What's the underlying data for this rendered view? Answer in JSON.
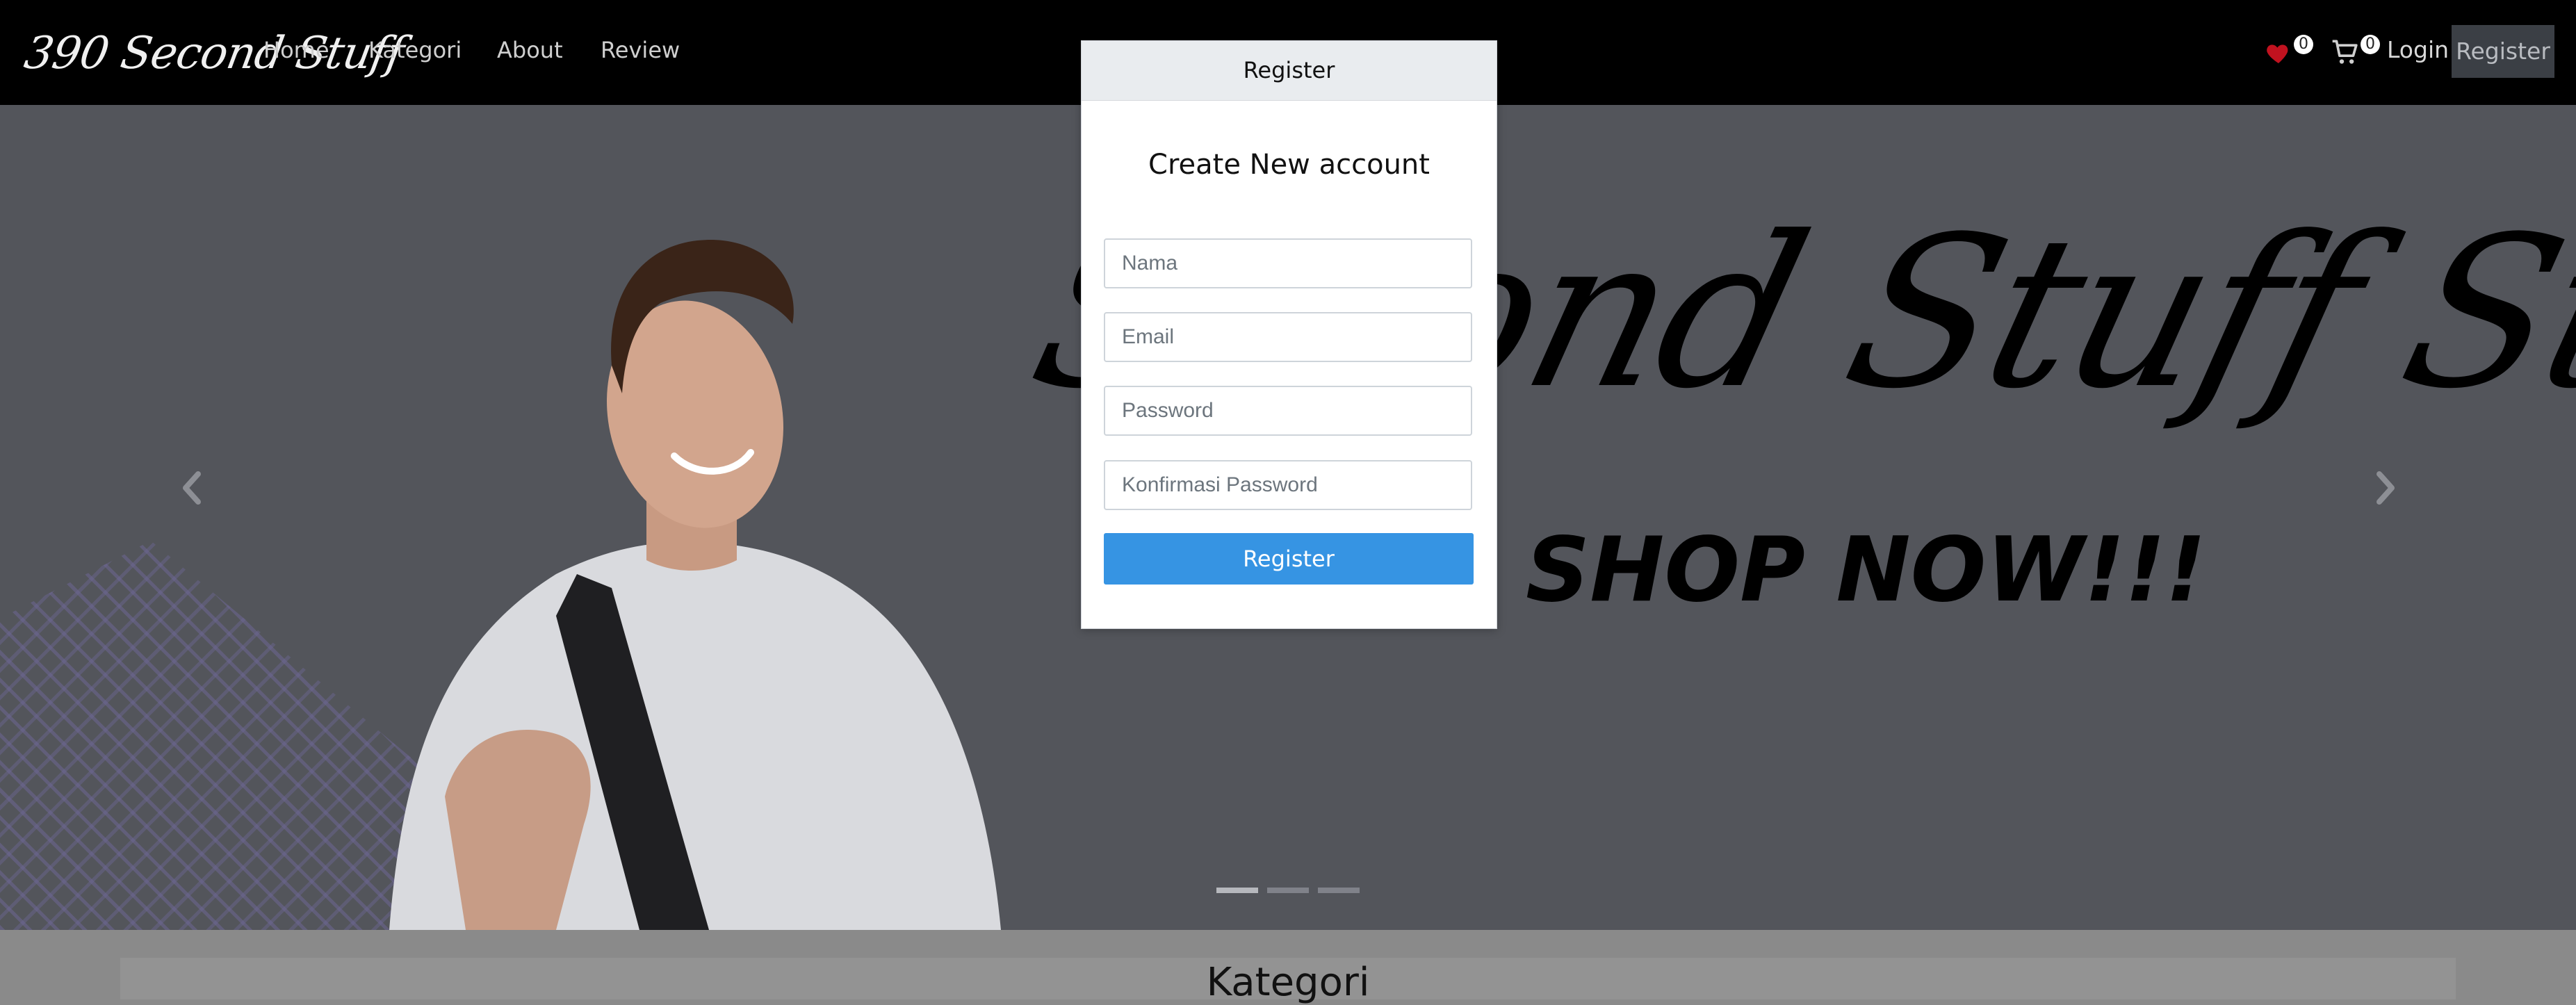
{
  "navbar": {
    "brand": "390 Second Stuff",
    "links": [
      "Home",
      "Kategori",
      "About",
      "Review"
    ],
    "wishlist_count": "0",
    "cart_count": "0",
    "login_label": "Login",
    "register_label": "Register"
  },
  "hero": {
    "script_text": "Second Stuff Stores",
    "cta_text": "SHOP NOW!!!",
    "prev_icon": "chevron-left-icon",
    "next_icon": "chevron-right-icon",
    "active_slide": 1,
    "slide_count": 3
  },
  "modal": {
    "header": "Register",
    "title": "Create New account",
    "fields": {
      "name_placeholder": "Nama",
      "email_placeholder": "Email",
      "password_placeholder": "Password",
      "confirm_placeholder": "Konfirmasi Password"
    },
    "submit_label": "Register"
  },
  "section": {
    "kategori_title": "Kategori"
  },
  "colors": {
    "navbar_bg": "#000000",
    "accent": "#3694e3",
    "heart": "#c1121f",
    "overlay": "#53555b"
  }
}
